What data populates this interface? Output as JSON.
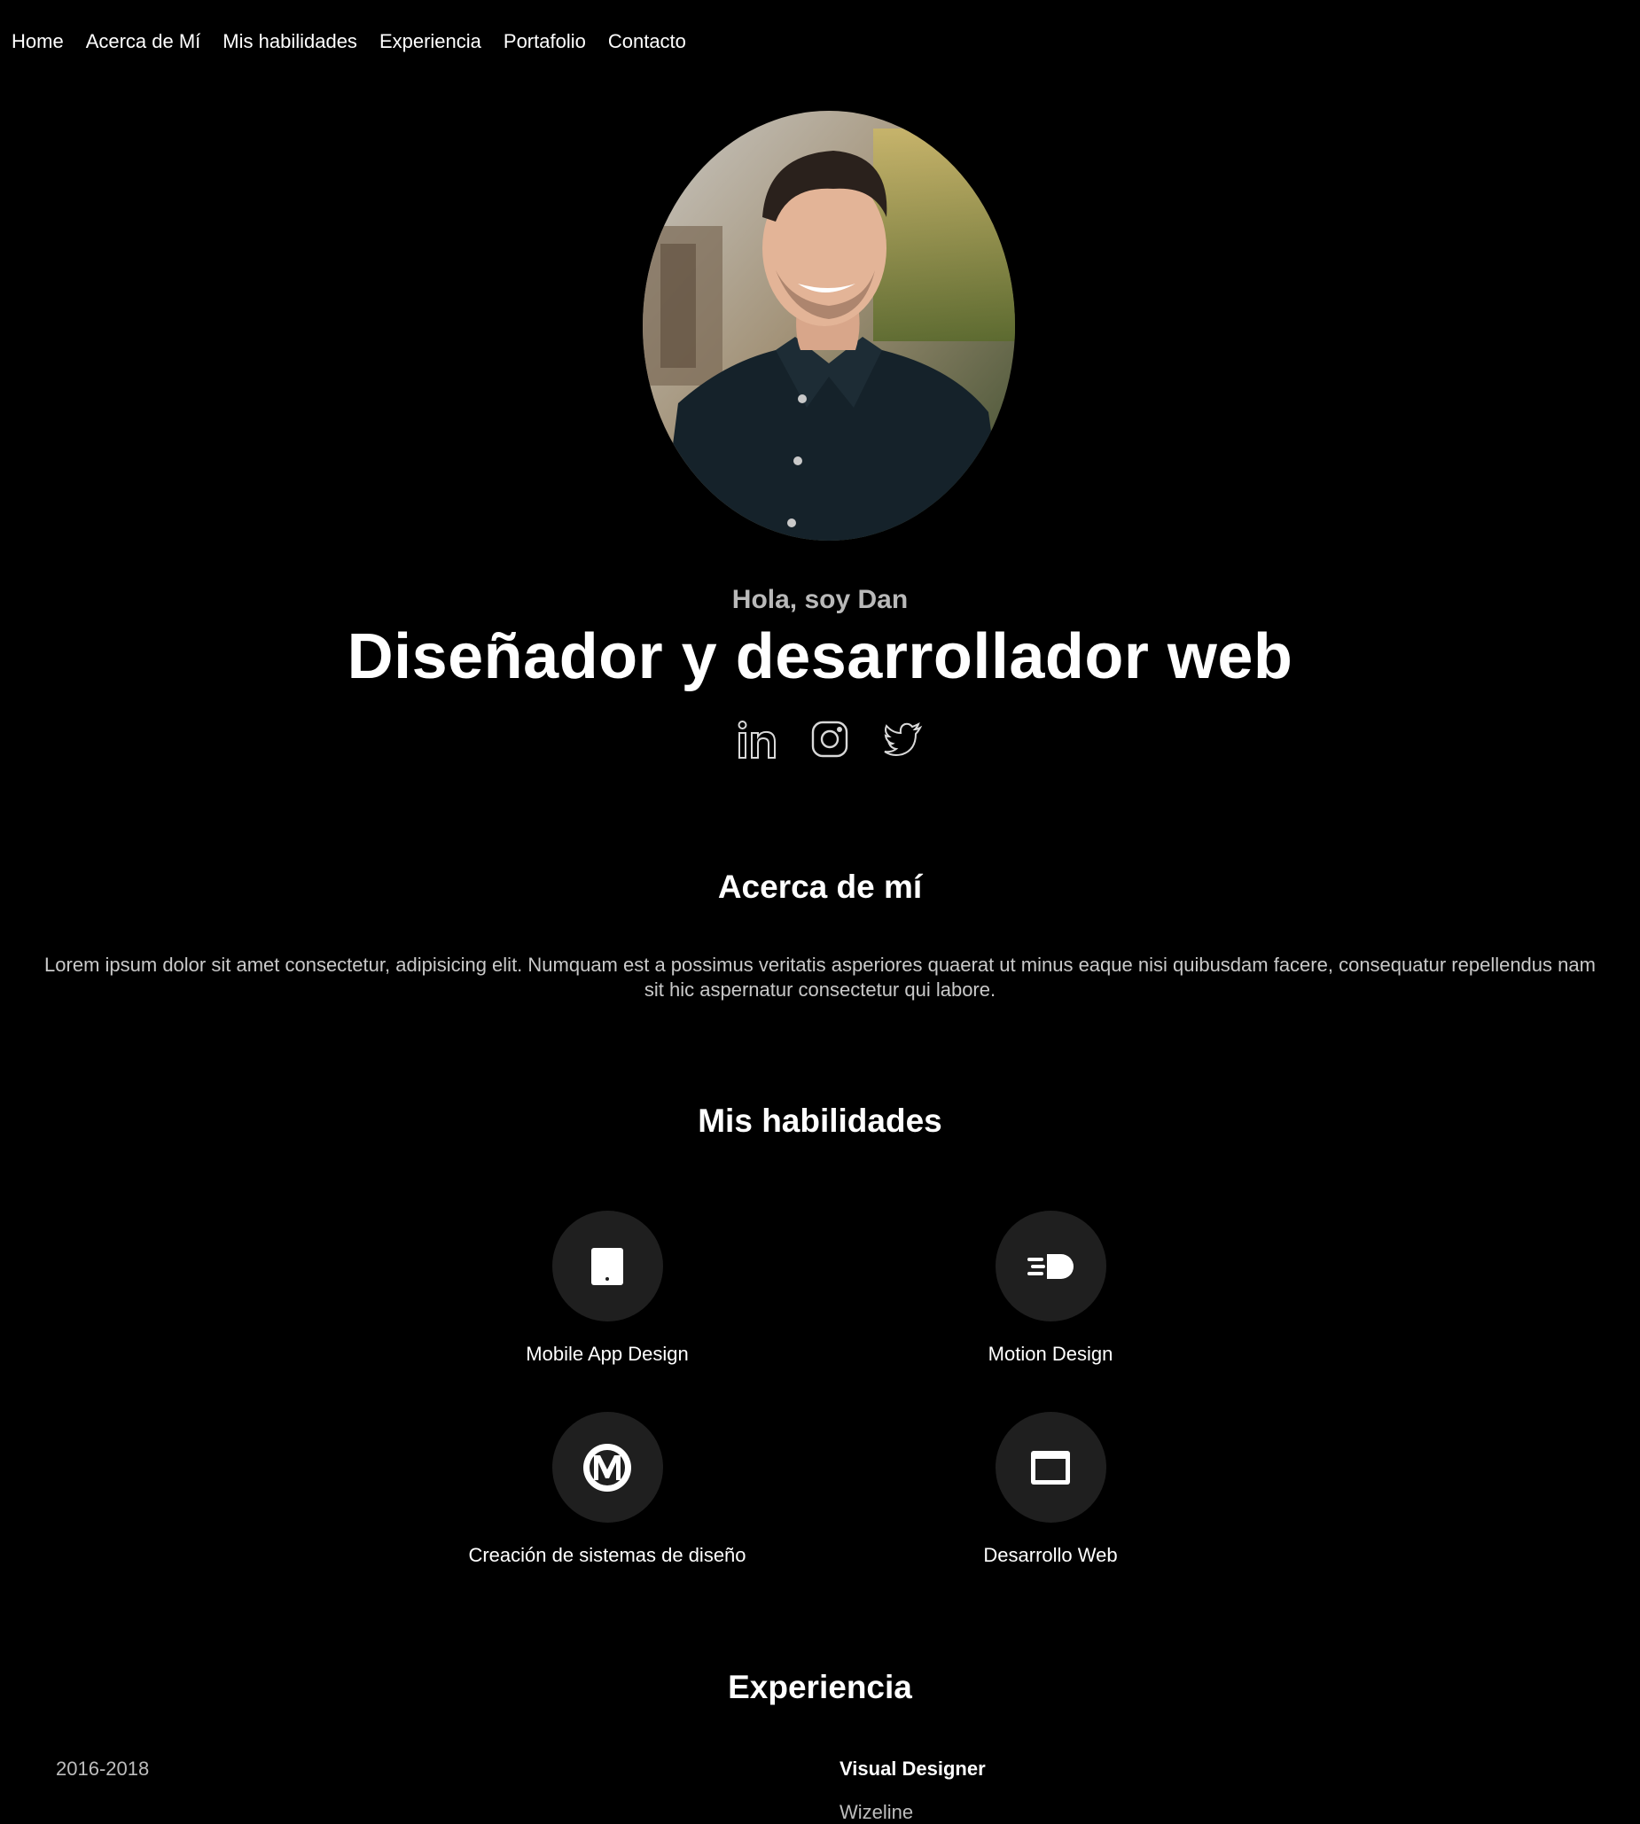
{
  "nav": {
    "items": [
      "Home",
      "Acerca de Mí",
      "Mis habilidades",
      "Experiencia",
      "Portafolio",
      "Contacto"
    ]
  },
  "hero": {
    "greeting": "Hola, soy Dan",
    "title": "Diseñador y desarrollador web",
    "socials": [
      "linkedin-icon",
      "instagram-icon",
      "twitter-icon"
    ]
  },
  "about": {
    "heading": "Acerca de mí",
    "text": "Lorem ipsum dolor sit amet consectetur, adipisicing elit. Numquam est a possimus veritatis asperiores quaerat ut minus eaque nisi quibusdam facere, consequatur repellendus nam sit hic aspernatur consectetur qui labore."
  },
  "skills": {
    "heading": "Mis habilidades",
    "items": [
      {
        "label": "Mobile App Design",
        "icon": "tablet-icon"
      },
      {
        "label": "Motion Design",
        "icon": "motion-icon"
      },
      {
        "label": "Creación de sistemas de diseño",
        "icon": "medium-icon"
      },
      {
        "label": "Desarrollo Web",
        "icon": "browser-window-icon"
      }
    ]
  },
  "experience": {
    "heading": "Experiencia",
    "entries": [
      {
        "years": "2016-2018",
        "role": "Visual Designer",
        "company": "Wizeline"
      }
    ]
  },
  "colors": {
    "background": "#000000",
    "text": "#ffffff",
    "muted": "#c9c9c9",
    "circle": "#1f1f1f"
  }
}
